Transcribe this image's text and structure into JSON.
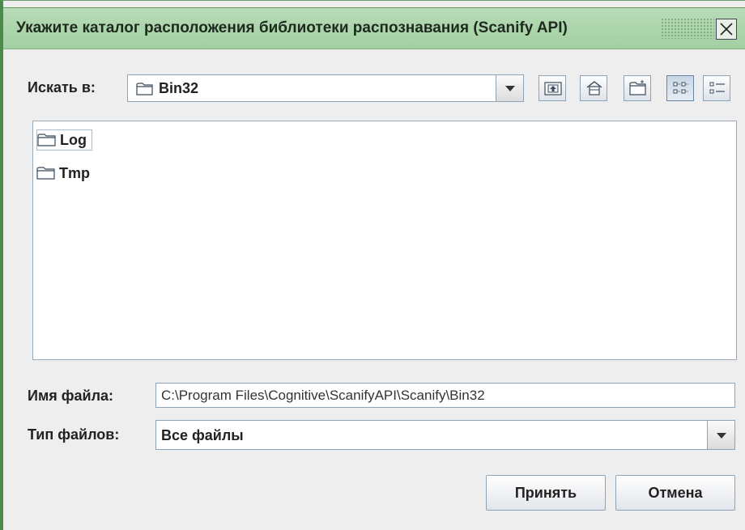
{
  "window": {
    "title": "Укажите каталог расположения библиотеки распознавания (Scanify API)"
  },
  "look_in": {
    "label": "Искать в:",
    "value": "Bin32"
  },
  "toolbar": {
    "icons": [
      "up-one-level-icon",
      "home-icon",
      "new-folder-icon",
      "list-view-icon",
      "details-view-icon"
    ]
  },
  "files": [
    {
      "name": "Log"
    },
    {
      "name": "Tmp"
    }
  ],
  "file_name": {
    "label": "Имя файла:",
    "value": "C:\\Program Files\\Cognitive\\ScanifyAPI\\Scanify\\Bin32"
  },
  "file_type": {
    "label": "Тип файлов:",
    "value": "Все файлы"
  },
  "buttons": {
    "accept": "Принять",
    "cancel": "Отмена"
  },
  "colors": {
    "titlebar": "#a2cfa2",
    "window_border": "#4c8a4c",
    "background": "#eeeeee"
  }
}
